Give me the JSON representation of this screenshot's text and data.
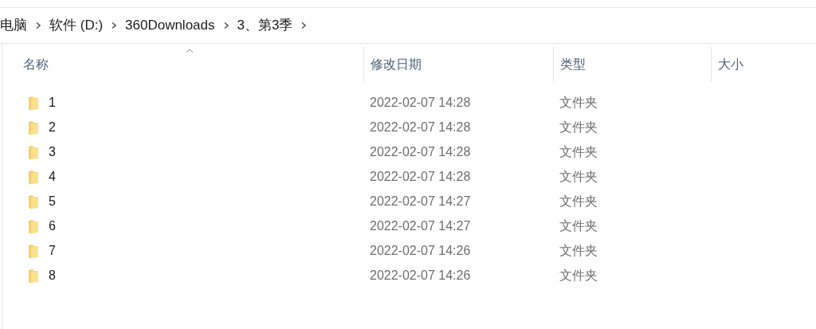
{
  "breadcrumb": [
    "电脑",
    "软件 (D:)",
    "360Downloads",
    "3、第3季"
  ],
  "columns": [
    "名称",
    "修改日期",
    "类型",
    "大小"
  ],
  "rows": [
    {
      "name": "1",
      "modified": "2022-02-07 14:28",
      "type": "文件夹"
    },
    {
      "name": "2",
      "modified": "2022-02-07 14:28",
      "type": "文件夹"
    },
    {
      "name": "3",
      "modified": "2022-02-07 14:28",
      "type": "文件夹"
    },
    {
      "name": "4",
      "modified": "2022-02-07 14:28",
      "type": "文件夹"
    },
    {
      "name": "5",
      "modified": "2022-02-07 14:27",
      "type": "文件夹"
    },
    {
      "name": "6",
      "modified": "2022-02-07 14:27",
      "type": "文件夹"
    },
    {
      "name": "7",
      "modified": "2022-02-07 14:26",
      "type": "文件夹"
    },
    {
      "name": "8",
      "modified": "2022-02-07 14:26",
      "type": "文件夹"
    }
  ]
}
